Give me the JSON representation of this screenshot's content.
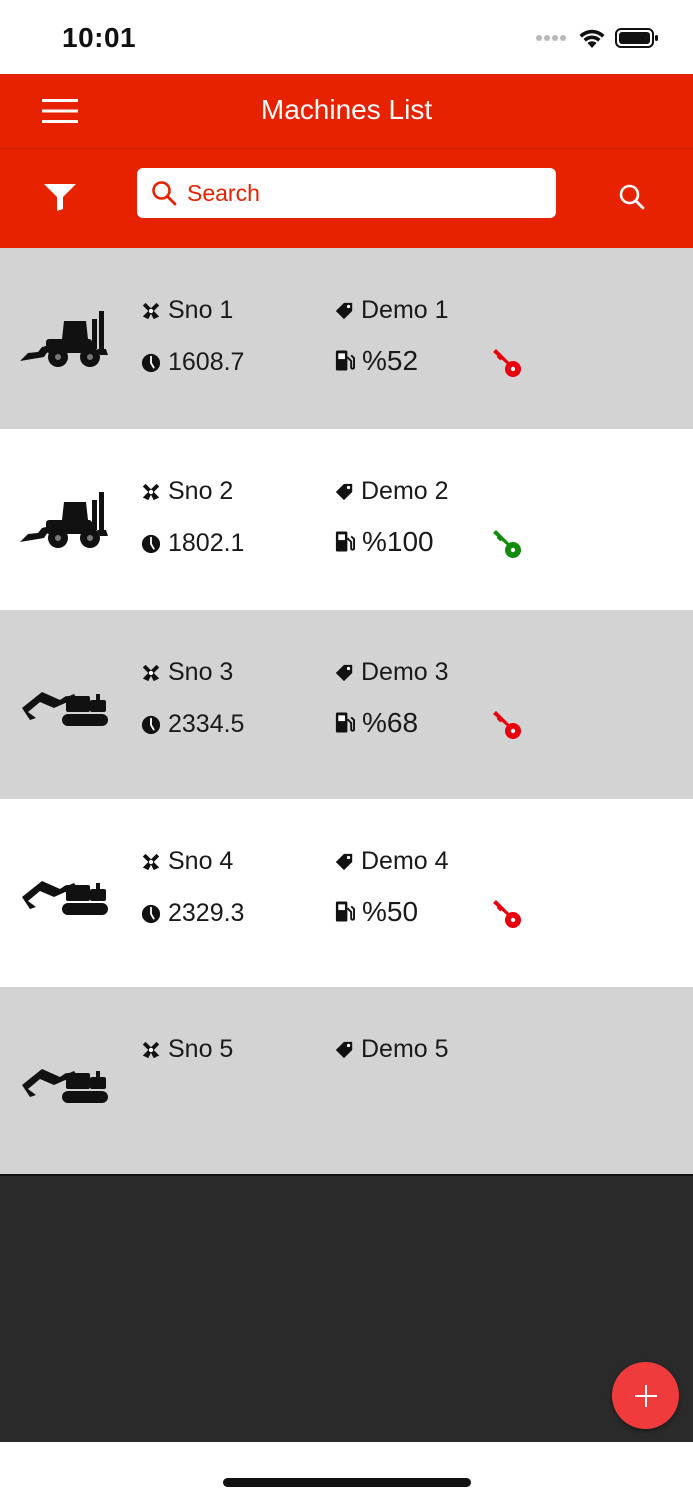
{
  "status_bar": {
    "time": "10:01"
  },
  "header": {
    "title": "Machines List",
    "menu_icon": "hamburger-menu-icon"
  },
  "search": {
    "placeholder": "Search",
    "filter_icon": "filter-icon",
    "search_icon": "search-icon"
  },
  "colors": {
    "brand_red": "#e62200",
    "row_alt": "#d3d3d3",
    "key_off": "#e8000b",
    "key_on": "#128a0b",
    "footer_dark": "#2b2a2a",
    "fab": "#ef3b3b"
  },
  "machines": [
    {
      "sno": "Sno 1",
      "name": "Demo 1",
      "hours": "1608.7",
      "fuel": "%52",
      "type": "backhoe-loader",
      "key_state": "off",
      "show_details": true
    },
    {
      "sno": "Sno 2",
      "name": "Demo 2",
      "hours": "1802.1",
      "fuel": "%100",
      "type": "backhoe-loader",
      "key_state": "on",
      "show_details": true
    },
    {
      "sno": "Sno 3",
      "name": "Demo 3",
      "hours": "2334.5",
      "fuel": "%68",
      "type": "excavator",
      "key_state": "off",
      "show_details": true
    },
    {
      "sno": "Sno 4",
      "name": "Demo 4",
      "hours": "2329.3",
      "fuel": "%50",
      "type": "excavator",
      "key_state": "off",
      "show_details": true
    },
    {
      "sno": "Sno 5",
      "name": "Demo 5",
      "hours": "",
      "fuel": "",
      "type": "excavator",
      "key_state": "none",
      "show_details": false
    }
  ],
  "fab": {
    "icon": "plus-icon"
  }
}
